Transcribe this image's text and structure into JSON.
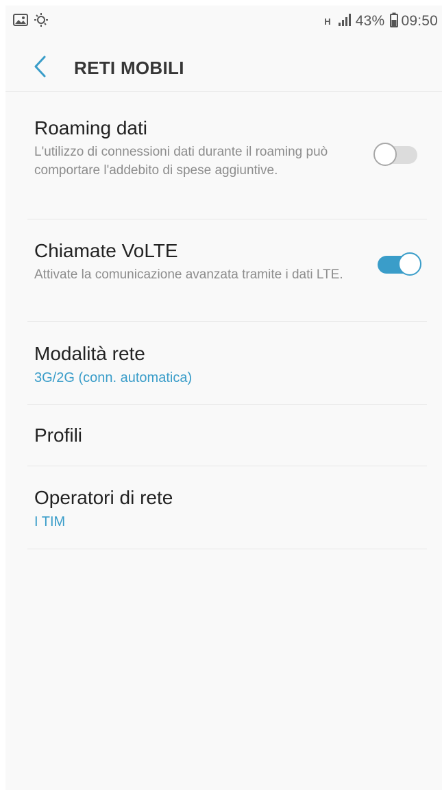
{
  "status_bar": {
    "left_icons": [
      "image-icon",
      "sync-icon"
    ],
    "network_type": "H",
    "signal_icon": "signal-icon",
    "battery_percent": "43%",
    "battery_icon": "battery-icon",
    "time": "09:50"
  },
  "header": {
    "back_icon": "chevron-left-icon",
    "title": "RETI MOBILI"
  },
  "colors": {
    "accent": "#3a9dc9",
    "toggle_off_track": "#dcdcdc",
    "background": "#f9f9f9"
  },
  "settings": {
    "roaming": {
      "title": "Roaming dati",
      "description": "L'utilizzo di connessioni dati durante il roaming può comportare l'addebito di spese aggiuntive.",
      "enabled": false
    },
    "volte": {
      "title": "Chiamate VoLTE",
      "description": "Attivate la comunicazione avanzata tramite i dati LTE.",
      "enabled": true
    },
    "network_mode": {
      "title": "Modalità rete",
      "value": "3G/2G (conn. automatica)"
    },
    "profiles": {
      "title": "Profili"
    },
    "operators": {
      "title": "Operatori di rete",
      "value": "I TIM"
    }
  }
}
